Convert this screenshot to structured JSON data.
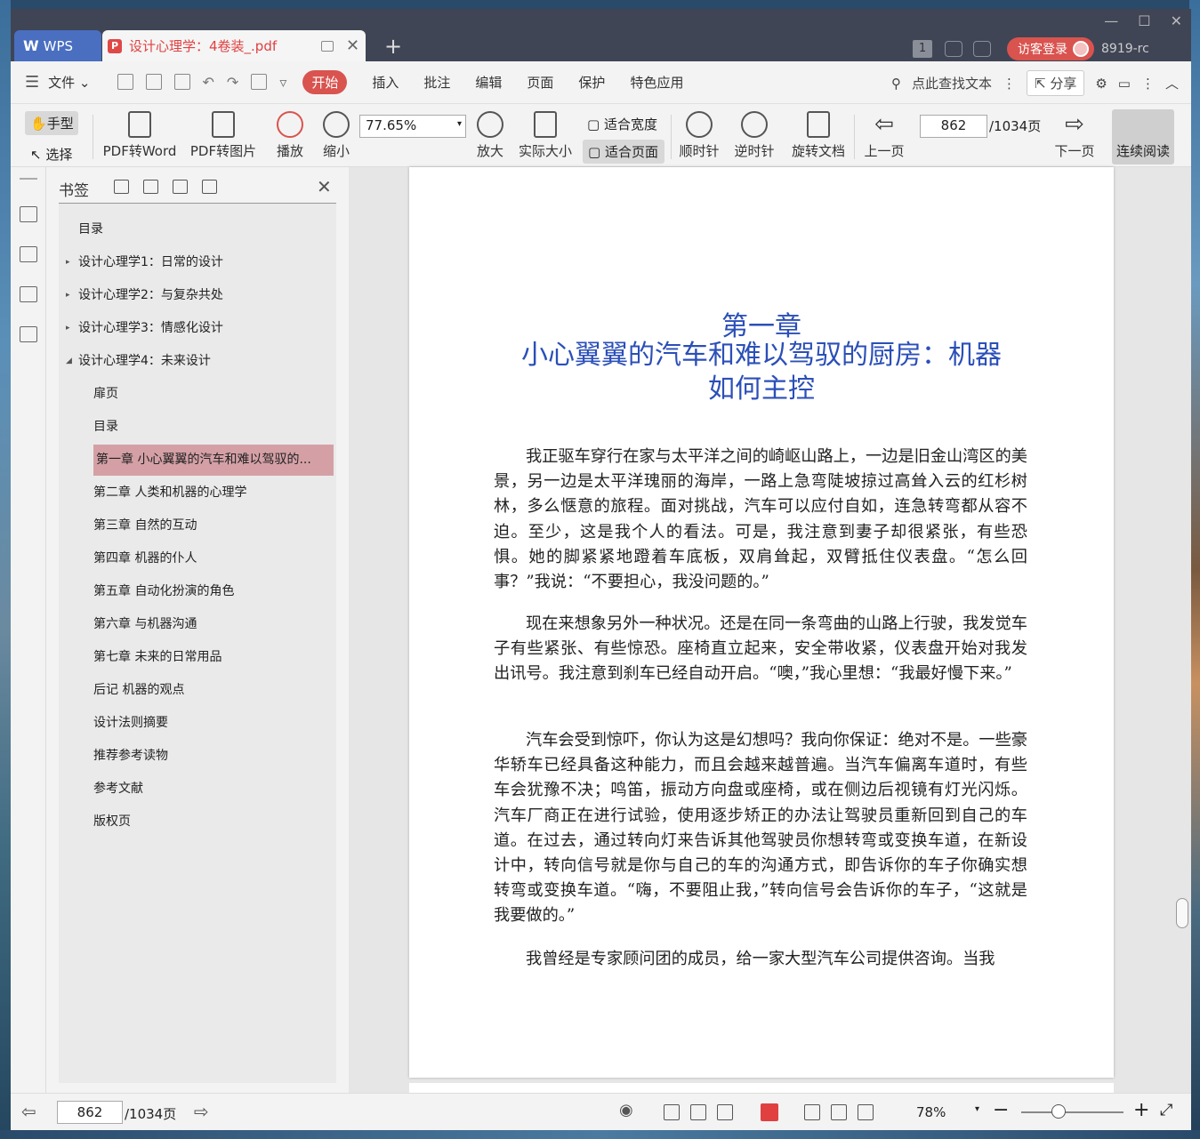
{
  "titlebar": {
    "app_tab": "WPS",
    "doc_tab": "设计心理学：4卷装_.pdf",
    "tab_count": "1",
    "login": "访客登录",
    "user_id": "8919-rc"
  },
  "menubar": {
    "file": "文件",
    "start": "开始",
    "items": [
      "插入",
      "批注",
      "编辑",
      "页面",
      "保护",
      "特色应用"
    ],
    "search": "点此查找文本",
    "share": "分享"
  },
  "ribbon": {
    "hand": "手型",
    "select": "选择",
    "pdf2word": "PDF转Word",
    "pdf2img": "PDF转图片",
    "play": "播放",
    "zoom_out": "缩小",
    "zoom_value": "77.65%",
    "zoom_in": "放大",
    "actual_size": "实际大小",
    "fit_width": "适合宽度",
    "fit_page": "适合页面",
    "clockwise": "顺时针",
    "counterclockwise": "逆时针",
    "rotate_doc": "旋转文档",
    "prev_page": "上一页",
    "page_current": "862",
    "page_total": "/1034页",
    "next_page": "下一页",
    "continuous": "连续阅读"
  },
  "bookmarks": {
    "title": "书签",
    "items": [
      {
        "label": "目录",
        "level": 0,
        "arrow": ""
      },
      {
        "label": "设计心理学1：日常的设计",
        "level": 0,
        "arrow": "▸"
      },
      {
        "label": "设计心理学2：与复杂共处",
        "level": 0,
        "arrow": "▸"
      },
      {
        "label": "设计心理学3：情感化设计",
        "level": 0,
        "arrow": "▸"
      },
      {
        "label": "设计心理学4：未来设计",
        "level": 0,
        "arrow": "◢"
      },
      {
        "label": "扉页",
        "level": 1,
        "arrow": ""
      },
      {
        "label": "目录",
        "level": 1,
        "arrow": ""
      },
      {
        "label": "第一章 小心翼翼的汽车和难以驾驭的...",
        "level": 1,
        "arrow": "",
        "selected": true
      },
      {
        "label": "第二章 人类和机器的心理学",
        "level": 1,
        "arrow": ""
      },
      {
        "label": "第三章 自然的互动",
        "level": 1,
        "arrow": ""
      },
      {
        "label": "第四章 机器的仆人",
        "level": 1,
        "arrow": ""
      },
      {
        "label": "第五章 自动化扮演的角色",
        "level": 1,
        "arrow": ""
      },
      {
        "label": "第六章 与机器沟通",
        "level": 1,
        "arrow": ""
      },
      {
        "label": "第七章 未来的日常用品",
        "level": 1,
        "arrow": ""
      },
      {
        "label": "后记 机器的观点",
        "level": 1,
        "arrow": ""
      },
      {
        "label": "设计法则摘要",
        "level": 1,
        "arrow": ""
      },
      {
        "label": "推荐参考读物",
        "level": 1,
        "arrow": ""
      },
      {
        "label": "参考文献",
        "level": 1,
        "arrow": ""
      },
      {
        "label": "版权页",
        "level": 1,
        "arrow": ""
      }
    ]
  },
  "document": {
    "chapter": "第一章",
    "title_line1": "小心翼翼的汽车和难以驾驭的厨房：机器",
    "title_line2": "如何主控",
    "paragraphs": [
      "我正驱车穿行在家与太平洋之间的崎岖山路上，一边是旧金山湾区的美景，另一边是太平洋瑰丽的海岸，一路上急弯陡坡掠过高耸入云的红杉树林，多么惬意的旅程。面对挑战，汽车可以应付自如，连急转弯都从容不迫。至少，这是我个人的看法。可是，我注意到妻子却很紧张，有些恐惧。她的脚紧紧地蹬着车底板，双肩耸起，双臂抵住仪表盘。“怎么回事？”我说：“不要担心，我没问题的。”",
      "现在来想象另外一种状况。还是在同一条弯曲的山路上行驶，我发觉车子有些紧张、有些惊恐。座椅直立起来，安全带收紧，仪表盘开始对我发出讯号。我注意到刹车已经自动开启。“噢，”我心里想：“我最好慢下来。”",
      "汽车会受到惊吓，你认为这是幻想吗？我向你保证：绝对不是。一些豪华轿车已经具备这种能力，而且会越来越普遍。当汽车偏离车道时，有些车会犹豫不决；鸣笛，振动方向盘或座椅，或在侧边后视镜有灯光闪烁。汽车厂商正在进行试验，使用逐步矫正的办法让驾驶员重新回到自己的车道。在过去，通过转向灯来告诉其他驾驶员你想转弯或变换车道，在新设计中，转向信号就是你与自己的车的沟通方式，即告诉你的车子你确实想转弯或变换车道。“嗨，不要阻止我，”转向信号会告诉你的车子，“这就是我要做的。”",
      "我曾经是专家顾问团的成员，给一家大型汽车公司提供咨询。当我"
    ]
  },
  "statusbar": {
    "page_current": "862",
    "page_total": "/1034页",
    "zoom": "78%"
  }
}
